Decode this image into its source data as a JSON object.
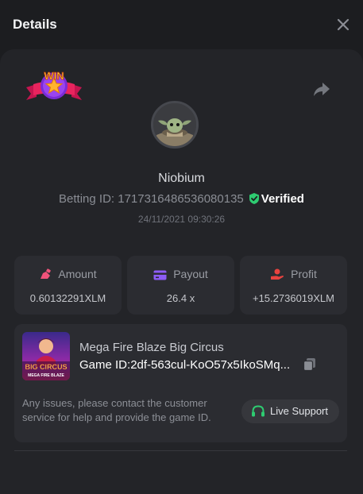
{
  "dialog": {
    "title": "Details",
    "close_icon": "close-icon"
  },
  "badge": {
    "label": "WIN",
    "icon": "win-badge-icon"
  },
  "share_icon": "share-icon",
  "player": {
    "username": "Niobium",
    "betting_id_label": "Betting ID:",
    "betting_id": "1717316486536080135",
    "verified_label": "Verified",
    "timestamp": "24/11/2021 09:30:26"
  },
  "stats": [
    {
      "label": "Amount",
      "value": "0.60132291XLM",
      "icon": "amount-icon"
    },
    {
      "label": "Payout",
      "value": "26.4 x",
      "icon": "payout-card-icon"
    },
    {
      "label": "Profit",
      "value": "+15.2736019XLM",
      "icon": "profit-hand-icon"
    }
  ],
  "game": {
    "name": "Mega Fire Blaze Big Circus",
    "id_label": "Game ID:",
    "id_value": "2df-563cul-KoO57x5IkoSMq...",
    "thumbnail_text_1": "BIG CIRCUS",
    "thumbnail_text_2": "MEGA FIRE BLAZE"
  },
  "help_text": "Any issues, please contact the customer service for help and provide the game ID.",
  "support_label": "Live Support",
  "colors": {
    "background": "#1c1d20",
    "panel": "#232428",
    "card": "#2b2c31",
    "verified_green": "#2ecc71",
    "amount_pink": "#f0527a",
    "payout_purple": "#8d5cf6",
    "profit_red": "#e8433f",
    "support_green": "#2ecc71"
  }
}
